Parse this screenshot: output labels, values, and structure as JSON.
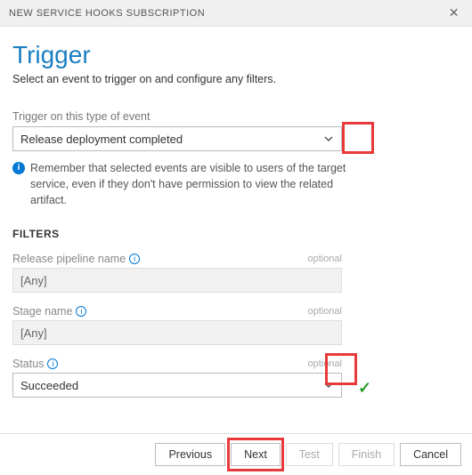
{
  "titlebar": {
    "text": "NEW SERVICE HOOKS SUBSCRIPTION"
  },
  "header": {
    "title": "Trigger",
    "subtitle": "Select an event to trigger on and configure any filters."
  },
  "eventField": {
    "label": "Trigger on this type of event",
    "value": "Release deployment completed"
  },
  "infoNote": "Remember that selected events are visible to users of the target service, even if they don't have permission to view the related artifact.",
  "filtersHeader": "FILTERS",
  "filters": {
    "pipeline": {
      "label": "Release pipeline name",
      "optional": "optional",
      "value": "[Any]"
    },
    "stage": {
      "label": "Stage name",
      "optional": "optional",
      "value": "[Any]"
    },
    "status": {
      "label": "Status",
      "optional": "optional",
      "value": "Succeeded"
    }
  },
  "buttons": {
    "previous": "Previous",
    "next": "Next",
    "test": "Test",
    "finish": "Finish",
    "cancel": "Cancel"
  }
}
